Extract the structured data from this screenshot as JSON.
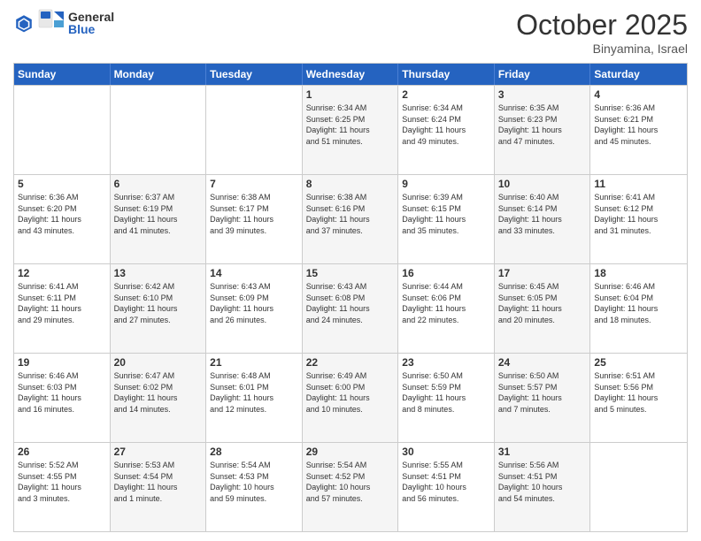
{
  "header": {
    "logo_general": "General",
    "logo_blue": "Blue",
    "month_title": "October 2025",
    "location": "Binyamina, Israel"
  },
  "days_of_week": [
    "Sunday",
    "Monday",
    "Tuesday",
    "Wednesday",
    "Thursday",
    "Friday",
    "Saturday"
  ],
  "rows": [
    [
      {
        "day": "",
        "info": "",
        "empty": true
      },
      {
        "day": "",
        "info": "",
        "empty": true
      },
      {
        "day": "",
        "info": "",
        "empty": true
      },
      {
        "day": "1",
        "info": "Sunrise: 6:34 AM\nSunset: 6:25 PM\nDaylight: 11 hours\nand 51 minutes.",
        "shaded": true
      },
      {
        "day": "2",
        "info": "Sunrise: 6:34 AM\nSunset: 6:24 PM\nDaylight: 11 hours\nand 49 minutes.",
        "shaded": false
      },
      {
        "day": "3",
        "info": "Sunrise: 6:35 AM\nSunset: 6:23 PM\nDaylight: 11 hours\nand 47 minutes.",
        "shaded": true
      },
      {
        "day": "4",
        "info": "Sunrise: 6:36 AM\nSunset: 6:21 PM\nDaylight: 11 hours\nand 45 minutes.",
        "shaded": false
      }
    ],
    [
      {
        "day": "5",
        "info": "Sunrise: 6:36 AM\nSunset: 6:20 PM\nDaylight: 11 hours\nand 43 minutes.",
        "shaded": false
      },
      {
        "day": "6",
        "info": "Sunrise: 6:37 AM\nSunset: 6:19 PM\nDaylight: 11 hours\nand 41 minutes.",
        "shaded": true
      },
      {
        "day": "7",
        "info": "Sunrise: 6:38 AM\nSunset: 6:17 PM\nDaylight: 11 hours\nand 39 minutes.",
        "shaded": false
      },
      {
        "day": "8",
        "info": "Sunrise: 6:38 AM\nSunset: 6:16 PM\nDaylight: 11 hours\nand 37 minutes.",
        "shaded": true
      },
      {
        "day": "9",
        "info": "Sunrise: 6:39 AM\nSunset: 6:15 PM\nDaylight: 11 hours\nand 35 minutes.",
        "shaded": false
      },
      {
        "day": "10",
        "info": "Sunrise: 6:40 AM\nSunset: 6:14 PM\nDaylight: 11 hours\nand 33 minutes.",
        "shaded": true
      },
      {
        "day": "11",
        "info": "Sunrise: 6:41 AM\nSunset: 6:12 PM\nDaylight: 11 hours\nand 31 minutes.",
        "shaded": false
      }
    ],
    [
      {
        "day": "12",
        "info": "Sunrise: 6:41 AM\nSunset: 6:11 PM\nDaylight: 11 hours\nand 29 minutes.",
        "shaded": false
      },
      {
        "day": "13",
        "info": "Sunrise: 6:42 AM\nSunset: 6:10 PM\nDaylight: 11 hours\nand 27 minutes.",
        "shaded": true
      },
      {
        "day": "14",
        "info": "Sunrise: 6:43 AM\nSunset: 6:09 PM\nDaylight: 11 hours\nand 26 minutes.",
        "shaded": false
      },
      {
        "day": "15",
        "info": "Sunrise: 6:43 AM\nSunset: 6:08 PM\nDaylight: 11 hours\nand 24 minutes.",
        "shaded": true
      },
      {
        "day": "16",
        "info": "Sunrise: 6:44 AM\nSunset: 6:06 PM\nDaylight: 11 hours\nand 22 minutes.",
        "shaded": false
      },
      {
        "day": "17",
        "info": "Sunrise: 6:45 AM\nSunset: 6:05 PM\nDaylight: 11 hours\nand 20 minutes.",
        "shaded": true
      },
      {
        "day": "18",
        "info": "Sunrise: 6:46 AM\nSunset: 6:04 PM\nDaylight: 11 hours\nand 18 minutes.",
        "shaded": false
      }
    ],
    [
      {
        "day": "19",
        "info": "Sunrise: 6:46 AM\nSunset: 6:03 PM\nDaylight: 11 hours\nand 16 minutes.",
        "shaded": false
      },
      {
        "day": "20",
        "info": "Sunrise: 6:47 AM\nSunset: 6:02 PM\nDaylight: 11 hours\nand 14 minutes.",
        "shaded": true
      },
      {
        "day": "21",
        "info": "Sunrise: 6:48 AM\nSunset: 6:01 PM\nDaylight: 11 hours\nand 12 minutes.",
        "shaded": false
      },
      {
        "day": "22",
        "info": "Sunrise: 6:49 AM\nSunset: 6:00 PM\nDaylight: 11 hours\nand 10 minutes.",
        "shaded": true
      },
      {
        "day": "23",
        "info": "Sunrise: 6:50 AM\nSunset: 5:59 PM\nDaylight: 11 hours\nand 8 minutes.",
        "shaded": false
      },
      {
        "day": "24",
        "info": "Sunrise: 6:50 AM\nSunset: 5:57 PM\nDaylight: 11 hours\nand 7 minutes.",
        "shaded": true
      },
      {
        "day": "25",
        "info": "Sunrise: 6:51 AM\nSunset: 5:56 PM\nDaylight: 11 hours\nand 5 minutes.",
        "shaded": false
      }
    ],
    [
      {
        "day": "26",
        "info": "Sunrise: 5:52 AM\nSunset: 4:55 PM\nDaylight: 11 hours\nand 3 minutes.",
        "shaded": false
      },
      {
        "day": "27",
        "info": "Sunrise: 5:53 AM\nSunset: 4:54 PM\nDaylight: 11 hours\nand 1 minute.",
        "shaded": true
      },
      {
        "day": "28",
        "info": "Sunrise: 5:54 AM\nSunset: 4:53 PM\nDaylight: 10 hours\nand 59 minutes.",
        "shaded": false
      },
      {
        "day": "29",
        "info": "Sunrise: 5:54 AM\nSunset: 4:52 PM\nDaylight: 10 hours\nand 57 minutes.",
        "shaded": true
      },
      {
        "day": "30",
        "info": "Sunrise: 5:55 AM\nSunset: 4:51 PM\nDaylight: 10 hours\nand 56 minutes.",
        "shaded": false
      },
      {
        "day": "31",
        "info": "Sunrise: 5:56 AM\nSunset: 4:51 PM\nDaylight: 10 hours\nand 54 minutes.",
        "shaded": true
      },
      {
        "day": "",
        "info": "",
        "empty": true
      }
    ]
  ]
}
